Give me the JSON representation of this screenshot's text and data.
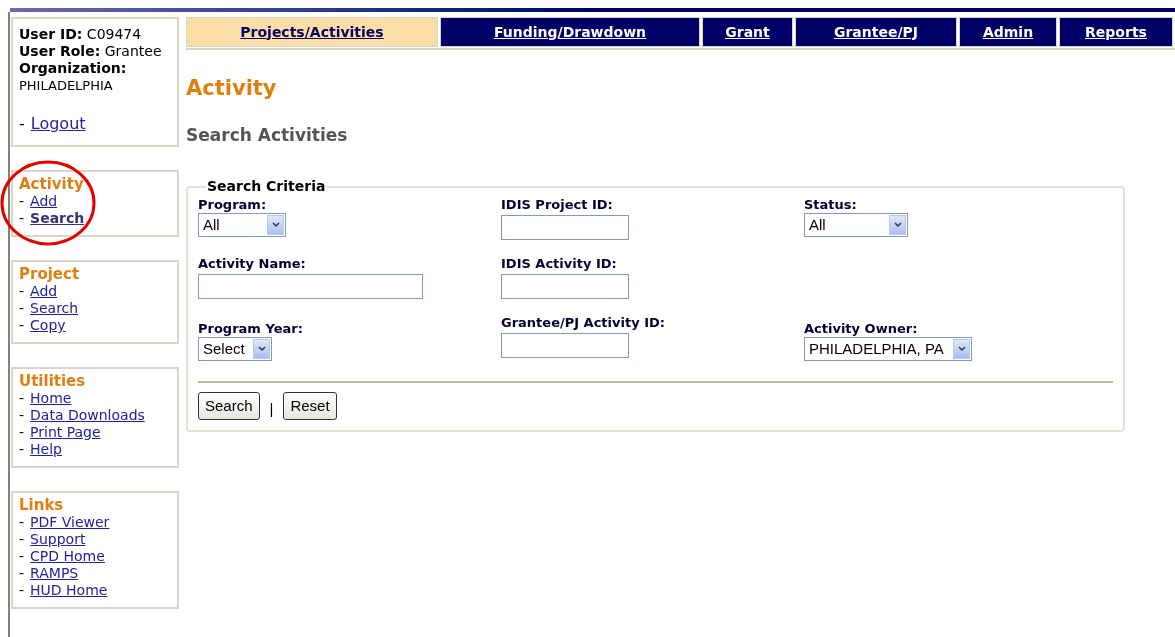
{
  "user": {
    "id_label": "User ID:",
    "id": "C09474",
    "role_label": "User Role:",
    "role": "Grantee",
    "org_label": "Organization:",
    "org": "PHILADELPHIA",
    "logout_bullet": "-",
    "logout": "Logout"
  },
  "sidebar": [
    {
      "title": "Activity",
      "highlighted": true,
      "items": [
        {
          "bullet": "-",
          "label": "Add",
          "selected": false
        },
        {
          "bullet": "-",
          "label": "Search",
          "selected": true
        }
      ]
    },
    {
      "title": "Project",
      "highlighted": false,
      "items": [
        {
          "bullet": "-",
          "label": "Add",
          "selected": false
        },
        {
          "bullet": "-",
          "label": "Search",
          "selected": false
        },
        {
          "bullet": "-",
          "label": "Copy",
          "selected": false
        }
      ]
    },
    {
      "title": "Utilities",
      "highlighted": false,
      "items": [
        {
          "bullet": "-",
          "label": "Home",
          "selected": false
        },
        {
          "bullet": "-",
          "label": "Data Downloads",
          "selected": false
        },
        {
          "bullet": "-",
          "label": "Print Page",
          "selected": false
        },
        {
          "bullet": "-",
          "label": "Help",
          "selected": false
        }
      ]
    },
    {
      "title": "Links",
      "highlighted": false,
      "items": [
        {
          "bullet": "-",
          "label": "PDF Viewer",
          "selected": false
        },
        {
          "bullet": "-",
          "label": "Support",
          "selected": false
        },
        {
          "bullet": "-",
          "label": "CPD Home",
          "selected": false
        },
        {
          "bullet": "-",
          "label": "RAMPS",
          "selected": false
        },
        {
          "bullet": "-",
          "label": "HUD Home",
          "selected": false
        }
      ]
    }
  ],
  "tabs": [
    {
      "label": "Projects/Activities",
      "selected": true
    },
    {
      "label": "Funding/Drawdown",
      "selected": false
    },
    {
      "label": "Grant",
      "selected": false
    },
    {
      "label": "Grantee/PJ",
      "selected": false
    },
    {
      "label": "Admin",
      "selected": false
    },
    {
      "label": "Reports",
      "selected": false
    }
  ],
  "page_title": "Activity",
  "subtitle": "Search Activities",
  "search_criteria": {
    "legend": "Search Criteria",
    "fields": [
      {
        "kind": "select",
        "label": "Program:",
        "value": "All"
      },
      {
        "kind": "text",
        "label": "IDIS Project ID:"
      },
      {
        "kind": "select",
        "label": "Status:",
        "value": "All"
      },
      {
        "kind": "text",
        "label": "Activity Name:"
      },
      {
        "kind": "text",
        "label": "IDIS Activity ID:"
      },
      {
        "kind": "empty"
      },
      {
        "kind": "select",
        "label": "Program Year:",
        "value": "Select"
      },
      {
        "kind": "text",
        "label": "Grantee/PJ Activity ID:"
      },
      {
        "kind": "select",
        "label": "Activity Owner:",
        "value": "PHILADELPHIA, PA"
      }
    ],
    "buttons": [
      "Search",
      "Reset"
    ],
    "separator": "|"
  }
}
